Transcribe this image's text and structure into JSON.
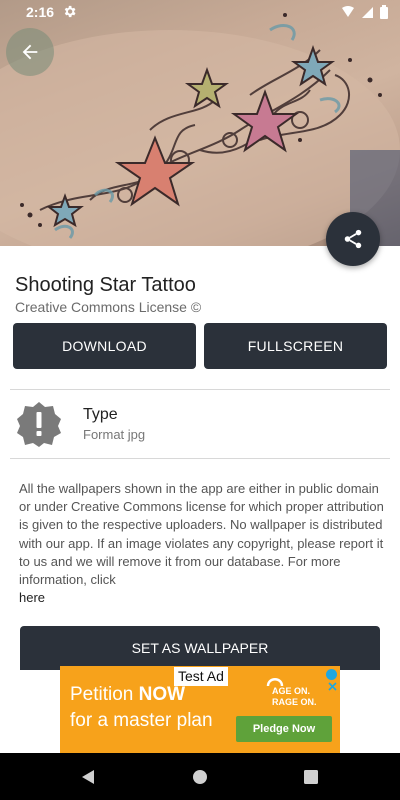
{
  "status_bar": {
    "time": "2:16"
  },
  "wallpaper": {
    "title": "Shooting Star Tattoo",
    "license": "Creative Commons License ©"
  },
  "actions": {
    "download_label": "DOWNLOAD",
    "fullscreen_label": "FULLSCREEN",
    "set_wallpaper_label": "SET AS WALLPAPER"
  },
  "type_info": {
    "title": "Type",
    "value": "Format jpg"
  },
  "description": {
    "text": "All the wallpapers shown in the app are either in public domain or under Creative Commons license for which proper attribution is given to the respective uploaders. No wallpaper is distributed with our app. If an image violates any copyright, please report it to us and we will remove it from our database. For more information, click",
    "link_label": "here"
  },
  "ad": {
    "label": "Test Ad",
    "line1_prefix": "Petition ",
    "line1_emphasis": "NOW",
    "line2": "for a master plan",
    "age_line1": "AGE ON.",
    "age_line2": "RAGE ON.",
    "cta": "Pledge Now"
  },
  "colors": {
    "primary_dark": "#2b313a",
    "ad_orange": "#f7a21b",
    "ad_green": "#5fa23a"
  },
  "icons": {
    "back": "arrow-left-icon",
    "share": "share-icon",
    "type": "alert-badge-icon",
    "settings": "gear-icon"
  }
}
